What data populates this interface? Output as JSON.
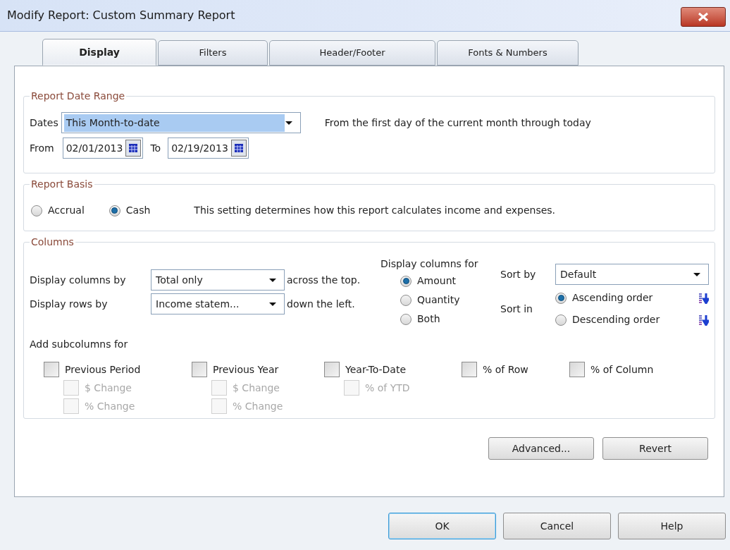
{
  "window": {
    "title": "Modify Report: Custom Summary Report"
  },
  "tabs": [
    {
      "label": "Display",
      "selected": true
    },
    {
      "label": "Filters",
      "selected": false
    },
    {
      "label": "Header/Footer",
      "selected": false
    },
    {
      "label": "Fonts & Numbers",
      "selected": false
    }
  ],
  "date_range": {
    "title": "Report Date Range",
    "dates_label": "Dates",
    "dates_value": "This Month-to-date",
    "dates_highlighted": true,
    "description": "From the first day of the current month through today",
    "from_label": "From",
    "from_value": "02/01/2013",
    "to_label": "To",
    "to_value": "02/19/2013"
  },
  "report_basis": {
    "title": "Report Basis",
    "options": [
      {
        "label": "Accrual",
        "selected": false
      },
      {
        "label": "Cash",
        "selected": true
      }
    ],
    "description": "This setting determines how this report calculates income and expenses."
  },
  "columns": {
    "title": "Columns",
    "columns_by": {
      "label": "Display columns by",
      "value": "Total only",
      "suffix": "across the top."
    },
    "rows_by": {
      "label": "Display rows by",
      "value": "Income statem...",
      "suffix": "down the left."
    },
    "display_for": {
      "title": "Display columns for",
      "options": [
        {
          "label": "Amount",
          "selected": true
        },
        {
          "label": "Quantity",
          "selected": false
        },
        {
          "label": "Both",
          "selected": false
        }
      ]
    },
    "sort_by": {
      "label": "Sort by",
      "value": "Default"
    },
    "sort_in": {
      "label": "Sort in",
      "options": [
        {
          "label": "Ascending order",
          "selected": true
        },
        {
          "label": "Descending order",
          "selected": false
        }
      ]
    },
    "subcolumns": {
      "title": "Add subcolumns for",
      "groups": [
        {
          "label": "Previous Period",
          "checked": false,
          "disabled": false,
          "children": [
            {
              "label": "$ Change",
              "checked": false,
              "disabled": true
            },
            {
              "label": "% Change",
              "checked": false,
              "disabled": true
            }
          ]
        },
        {
          "label": "Previous Year",
          "checked": false,
          "disabled": false,
          "children": [
            {
              "label": "$ Change",
              "checked": false,
              "disabled": true
            },
            {
              "label": "% Change",
              "checked": false,
              "disabled": true
            }
          ]
        },
        {
          "label": "Year-To-Date",
          "checked": false,
          "disabled": false,
          "children": [
            {
              "label": "% of YTD",
              "checked": false,
              "disabled": true
            }
          ]
        },
        {
          "label": "% of Row",
          "checked": false,
          "disabled": false
        },
        {
          "label": "% of Column",
          "checked": false,
          "disabled": false
        }
      ]
    }
  },
  "panel_buttons": [
    {
      "label": "Advanced..."
    },
    {
      "label": "Revert"
    }
  ],
  "footer_buttons": [
    {
      "label": "OK",
      "default": true
    },
    {
      "label": "Cancel",
      "default": false
    },
    {
      "label": "Help",
      "default": false
    }
  ]
}
